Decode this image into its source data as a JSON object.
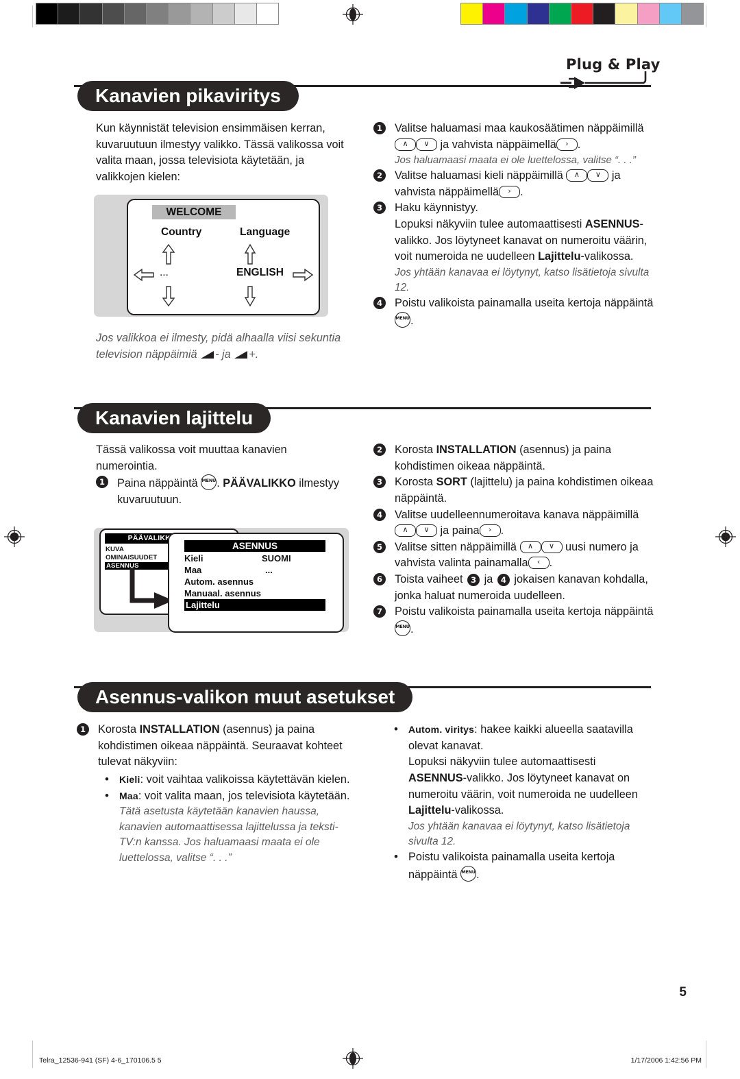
{
  "calibration": {
    "gray_swatches": [
      "#000000",
      "#1c1c1c",
      "#333333",
      "#4d4d4d",
      "#666666",
      "#808080",
      "#999999",
      "#b3b3b3",
      "#cccccc",
      "#e8e8e8",
      "#ffffff"
    ],
    "color_swatches": [
      "#fff200",
      "#ec008c",
      "#00a3e0",
      "#2e3192",
      "#00a650",
      "#ed1c24",
      "#231f20",
      "#fbf3a0",
      "#f59fc4",
      "#62c8f5",
      "#939598"
    ]
  },
  "logo": {
    "plug_play_text": "Plug & Play"
  },
  "sections": [
    {
      "id": "quick-install",
      "heading": "Kanavien pikaviritys",
      "intro": "Kun käynnistät television ensimmäisen kerran, kuvaruutuun ilmestyy valikko. Tässä valikossa voit valita maan, jossa televisiota käytetään, ja valikkojen kielen:",
      "caption": "Jos valikkoa ei ilmesty, pidä alhaalla viisi sekuntia television näppäimiä  ▱- ja ▱+.",
      "caption_line1": "Jos valikkoa ei ilmesty, pidä alhaalla viisi sekuntia",
      "caption_line2_pre": "television näppäimiä",
      "caption_line2_mid": "- ja",
      "caption_line2_post": "+.",
      "diagram": {
        "title": "WELCOME",
        "left_label": "Country",
        "right_label": "Language",
        "left_value": "...",
        "right_value": "ENGLISH"
      },
      "steps": [
        {
          "n": "1",
          "text_a": "Valitse haluamasi maa kaukosäätimen näppäimillä",
          "keys": [
            "∧",
            "∨"
          ],
          "text_b": "ja vahvista näppäimellä",
          "key_b": "›",
          "text_c": ".",
          "note": "Jos haluamaasi maata ei ole luettelossa, valitse “. . .”"
        },
        {
          "n": "2",
          "text_a": "Valitse haluamasi kieli näppäimillä",
          "keys": [
            "∧",
            "∨"
          ],
          "text_b": "ja vahvista näppäimellä",
          "key_b": "›",
          "text_c": "."
        },
        {
          "n": "3",
          "line1": "Haku käynnistyy.",
          "line2": "Lopuksi näkyviin tulee automaattisesti",
          "bold1": "ASENNUS",
          "line3": "-valikko. Jos löytyneet kanavat on numeroitu väärin, voit numeroida ne uudelleen ",
          "bold2": "Lajittelu",
          "line4": "-valikossa.",
          "note": "Jos yhtään kanavaa ei löytynyt, katso lisätietoja sivulta 12."
        },
        {
          "n": "4",
          "text_a": "Poistu valikoista painamalla useita kertoja näppäintä",
          "key_menu": "MENU",
          "text_c": "."
        }
      ]
    },
    {
      "id": "channel-sort",
      "heading": "Kanavien lajittelu",
      "intro_line1": "Tässä valikossa voit muuttaa kanavien",
      "intro_line2": "numerointia.",
      "step1": {
        "n": "1",
        "text_a": "Paina näppäintä",
        "key_menu": "MENU",
        "text_b": ".",
        "bold": "PÄÄVALIKKO",
        "text_c": "ilmestyy kuvaruutuun."
      },
      "diagram": {
        "small_menu_title": "PÄÄVALIKKO",
        "small_menu_items": [
          "KUVA",
          "OMINAISUUDET",
          "ASENNUS"
        ],
        "small_menu_selected": "ASENNUS",
        "main_title": "ASENNUS",
        "rows": [
          {
            "label": "Kieli",
            "value": "SUOMI",
            "selected": false
          },
          {
            "label": "Maa",
            "value": "...",
            "selected": false
          },
          {
            "label": "Autom. asennus",
            "value": "",
            "selected": false
          },
          {
            "label": "Manuaal. asennus",
            "value": "",
            "selected": false
          },
          {
            "label": "Lajittelu",
            "value": "",
            "selected": true
          }
        ]
      },
      "steps": [
        {
          "n": "2",
          "text_a": "Korosta ",
          "bold": "INSTALLATION",
          "text_b": " (asennus) ja paina kohdistimen oikeaa näppäintä."
        },
        {
          "n": "3",
          "text_a": "Korosta ",
          "bold": "SORT",
          "text_b": " (lajittelu) ja paina kohdistimen oikeaa näppäintä."
        },
        {
          "n": "4",
          "text_a": "Valitse uudelleennumeroitava kanava näppäimillä",
          "keys": [
            "∧",
            "∨"
          ],
          "text_b": "ja paina",
          "key_b": "›",
          "text_c": "."
        },
        {
          "n": "5",
          "text_a": "Valitse sitten näppäimillä",
          "keys": [
            "∧",
            "∨"
          ],
          "text_b": "uusi numero ja vahvista valinta painamalla",
          "key_b": "‹",
          "text_c": "."
        },
        {
          "n": "6",
          "text_a": "Toista vaiheet ",
          "inline_nums": [
            "3",
            "4"
          ],
          "text_mid": " ja ",
          "text_b": " jokaisen kanavan kohdalla, jonka haluat numeroida uudelleen."
        },
        {
          "n": "7",
          "text_a": "Poistu valikoista painamalla useita kertoja näppäintä",
          "key_menu": "MENU",
          "text_c": "."
        }
      ]
    },
    {
      "id": "other-install",
      "heading": "Asennus-valikon muut asetukset",
      "left": {
        "step1": {
          "n": "1",
          "text_a": "Korosta ",
          "bold": "INSTALLATION",
          "text_b": " (asennus) ja paina kohdistimen oikeaa näppäintä. Seuraavat kohteet tulevat näkyviin:"
        },
        "bullets": [
          {
            "term": "Kieli",
            "text": ": voit vaihtaa valikoissa käytettävän kielen."
          },
          {
            "term": "Maa",
            "text": ": voit valita maan, jos televisiota käytetään.",
            "note": "Tätä asetusta käytetään kanavien haussa, kanavien automaattisessa lajittelussa ja teksti-TV:n kanssa. Jos haluamaasi maata ei ole luettelossa, valitse “. . .”"
          }
        ]
      },
      "right": {
        "bullets": [
          {
            "term": "Autom. viritys",
            "text": ": hakee kaikki alueella saatavilla olevat kanavat.",
            "line2": "Lopuksi näkyviin tulee automaattisesti ",
            "bold1": "ASENNUS",
            "line3": "-valikko. Jos löytyneet kanavat on numeroitu väärin, voit numeroida ne uudelleen ",
            "bold2": "Lajittelu",
            "line4": "-valikossa.",
            "note": "Jos yhtään kanavaa ei löytynyt, katso lisätietoja sivulta 12."
          },
          {
            "text_plain": "Poistu valikoista painamalla useita kertoja näppäintä",
            "key_menu": "MENU",
            "text_end": "."
          }
        ]
      }
    }
  ],
  "page_number": "5",
  "footer": {
    "left": "Telra_12536-941 (SF) 4-6_170106.5   5",
    "right": "1/17/2006   1:42:56 PM"
  }
}
